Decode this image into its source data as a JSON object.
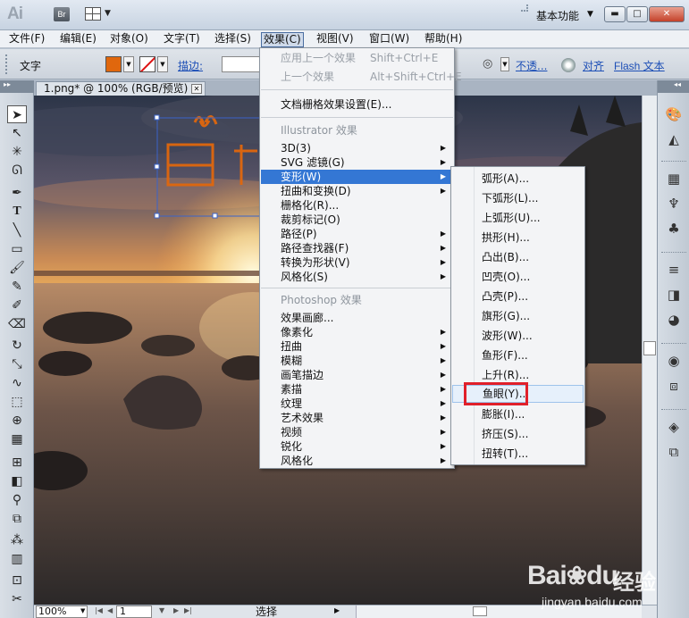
{
  "titlebar": {
    "app_logo": "Ai",
    "bridge_label": "Br",
    "workspace": "基本功能",
    "minimize": "▬",
    "maximize": "□",
    "close": "✕"
  },
  "menubar": {
    "items": [
      {
        "label": "文件(F)"
      },
      {
        "label": "编辑(E)"
      },
      {
        "label": "对象(O)"
      },
      {
        "label": "文字(T)"
      },
      {
        "label": "选择(S)"
      },
      {
        "label": "效果(C)"
      },
      {
        "label": "视图(V)"
      },
      {
        "label": "窗口(W)"
      },
      {
        "label": "帮助(H)"
      }
    ],
    "active": "效果(C)"
  },
  "controlbar": {
    "tool_label": "文字",
    "fill_color": "#e0670d",
    "stroke_label": "描边:",
    "opacity_label": "不透...",
    "align_label": "对齐",
    "flash_text_label": "Flash 文本"
  },
  "document": {
    "tab_title": "1.png* @ 100% (RGB/预览)",
    "tab_close": "✕",
    "selected_text_color": "#e0670d"
  },
  "statusbar": {
    "zoom": "100%",
    "page": "1",
    "status": "选择"
  },
  "effect_menu": {
    "items": [
      {
        "label": "应用上一个效果",
        "shortcut": "Shift+Ctrl+E",
        "disabled": true
      },
      {
        "label": "上一个效果",
        "shortcut": "Alt+Shift+Ctrl+E",
        "disabled": true
      },
      {
        "label": "文档栅格效果设置(E)..."
      },
      {
        "header": "Illustrator 效果"
      },
      {
        "label": "3D(3)",
        "submenu": true
      },
      {
        "label": "SVG 滤镜(G)",
        "submenu": true
      },
      {
        "label": "变形(W)",
        "submenu": true,
        "highlighted": true
      },
      {
        "label": "扭曲和变换(D)",
        "submenu": true
      },
      {
        "label": "栅格化(R)..."
      },
      {
        "label": "裁剪标记(O)"
      },
      {
        "label": "路径(P)",
        "submenu": true
      },
      {
        "label": "路径查找器(F)",
        "submenu": true
      },
      {
        "label": "转换为形状(V)",
        "submenu": true
      },
      {
        "label": "风格化(S)",
        "submenu": true
      },
      {
        "header": "Photoshop 效果"
      },
      {
        "label": "效果画廊..."
      },
      {
        "label": "像素化",
        "submenu": true
      },
      {
        "label": "扭曲",
        "submenu": true
      },
      {
        "label": "模糊",
        "submenu": true
      },
      {
        "label": "画笔描边",
        "submenu": true
      },
      {
        "label": "素描",
        "submenu": true
      },
      {
        "label": "纹理",
        "submenu": true
      },
      {
        "label": "艺术效果",
        "submenu": true
      },
      {
        "label": "视频",
        "submenu": true
      },
      {
        "label": "锐化",
        "submenu": true
      },
      {
        "label": "风格化",
        "submenu": true
      }
    ]
  },
  "warp_submenu": {
    "items": [
      {
        "label": "弧形(A)..."
      },
      {
        "label": "下弧形(L)..."
      },
      {
        "label": "上弧形(U)..."
      },
      {
        "label": "拱形(H)..."
      },
      {
        "label": "凸出(B)..."
      },
      {
        "label": "凹壳(O)..."
      },
      {
        "label": "凸壳(P)..."
      },
      {
        "label": "旗形(G)..."
      },
      {
        "label": "波形(W)..."
      },
      {
        "label": "鱼形(F)..."
      },
      {
        "label": "上升(R)..."
      },
      {
        "label": "鱼眼(Y)..",
        "hovered": true
      },
      {
        "label": "膨胀(I)..."
      },
      {
        "label": "挤压(S)..."
      },
      {
        "label": "扭转(T)..."
      }
    ],
    "highlight_color": "#e0202a"
  },
  "watermark": {
    "brand": "Bai",
    "brand_suffix": "du",
    "cn": "经验",
    "url": "jingyan.baidu.com"
  }
}
